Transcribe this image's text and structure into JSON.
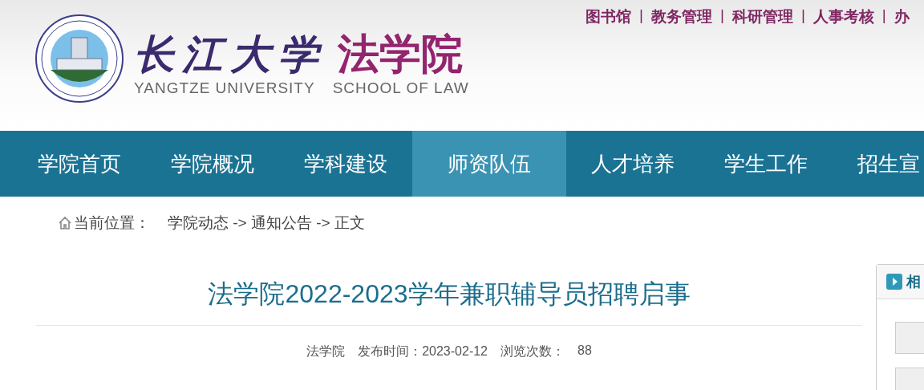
{
  "header": {
    "university_name": "长江大学",
    "school_name": "法学院",
    "university_name_en": "YANGTZE UNIVERSITY",
    "school_name_en": "SCHOOL OF LAW",
    "top_links": [
      {
        "kind": "link",
        "text": "图书馆"
      },
      {
        "kind": "separator",
        "text": "|"
      },
      {
        "kind": "link",
        "text": "教务管理"
      },
      {
        "kind": "separator",
        "text": "|"
      },
      {
        "kind": "link",
        "text": "科研管理"
      },
      {
        "kind": "separator",
        "text": "|"
      },
      {
        "kind": "link",
        "text": "人事考核"
      },
      {
        "kind": "separator",
        "text": "|"
      },
      {
        "kind": "link",
        "text": "办"
      }
    ]
  },
  "nav": [
    {
      "label": "学院首页",
      "selected": false
    },
    {
      "label": "学院概况",
      "selected": false
    },
    {
      "label": "学科建设",
      "selected": false
    },
    {
      "label": "师资队伍",
      "selected": true
    },
    {
      "label": "人才培养",
      "selected": false
    },
    {
      "label": "学生工作",
      "selected": false
    },
    {
      "label": "招生宣",
      "selected": false
    }
  ],
  "breadcrumb": {
    "label": "当前位置：",
    "path": "学院动态 -> 通知公告 -> 正文"
  },
  "article": {
    "title": "法学院2022-2023学年兼职辅导员招聘启事",
    "source": "法学院",
    "date_label": "发布时间：2023-02-12",
    "views_label": "浏览次数：",
    "views": "88"
  },
  "side_panel": {
    "title": "相"
  }
}
